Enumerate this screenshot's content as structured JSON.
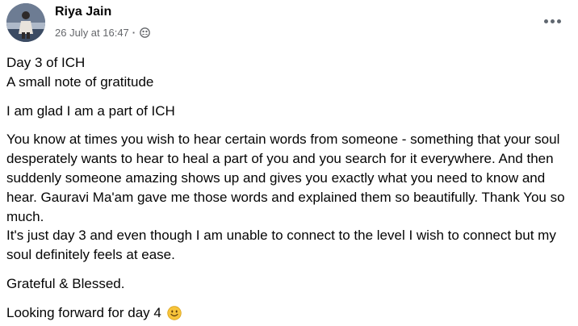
{
  "post": {
    "author": "Riya Jain",
    "timestamp": "26 July at 16:47",
    "separator": "·",
    "audience_icon": "friends-icon",
    "more_icon": "more-options-icon",
    "lines": {
      "l1": "Day 3 of ICH",
      "l2": "A small note of gratitude",
      "l3": "I am glad I am a part of ICH",
      "l4": "You know at times you wish to hear certain words from someone - something that your soul desperately wants to hear to heal a part of you and you search for it everywhere. And then suddenly someone amazing shows up and gives you exactly what you need to know and hear. Gauravi Ma'am gave me those words and explained them so beautifully. Thank You so much.",
      "l5": "It's just day 3 and even though I am unable to connect to the level I wish to connect but my soul definitely feels at ease.",
      "l6": "Grateful & Blessed.",
      "l7": "Looking forward for day 4"
    },
    "emoji_icon": "smiling-face-emoji"
  },
  "colors": {
    "text_primary": "#050505",
    "text_secondary": "#65676b",
    "icon_gray": "#606770",
    "emoji_yellow": "#f7c43b"
  }
}
